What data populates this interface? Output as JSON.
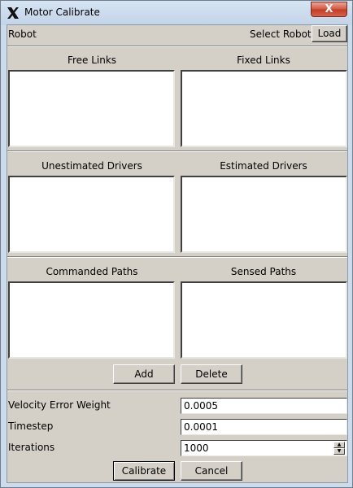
{
  "window": {
    "title": "Motor Calibrate",
    "close_glyph": "X"
  },
  "robot_row": {
    "label": "Robot",
    "select_label": "Select Robot",
    "load_button": "Load"
  },
  "sections": [
    {
      "left_title": "Free Links",
      "right_title": "Fixed Links"
    },
    {
      "left_title": "Unestimated Drivers",
      "right_title": "Estimated Drivers"
    },
    {
      "left_title": "Commanded Paths",
      "right_title": "Sensed Paths"
    }
  ],
  "path_buttons": {
    "add": "Add",
    "delete": "Delete"
  },
  "params": {
    "velocity_error_weight": {
      "label": "Velocity Error Weight",
      "value": "0.0005"
    },
    "timestep": {
      "label": "Timestep",
      "value": "0.0001"
    },
    "iterations": {
      "label": "Iterations",
      "value": "1000"
    }
  },
  "actions": {
    "calibrate": "Calibrate",
    "cancel": "Cancel"
  },
  "icons": {
    "app": "x-app-icon",
    "spin_up": "spin-up-icon",
    "spin_down": "spin-down-icon"
  }
}
